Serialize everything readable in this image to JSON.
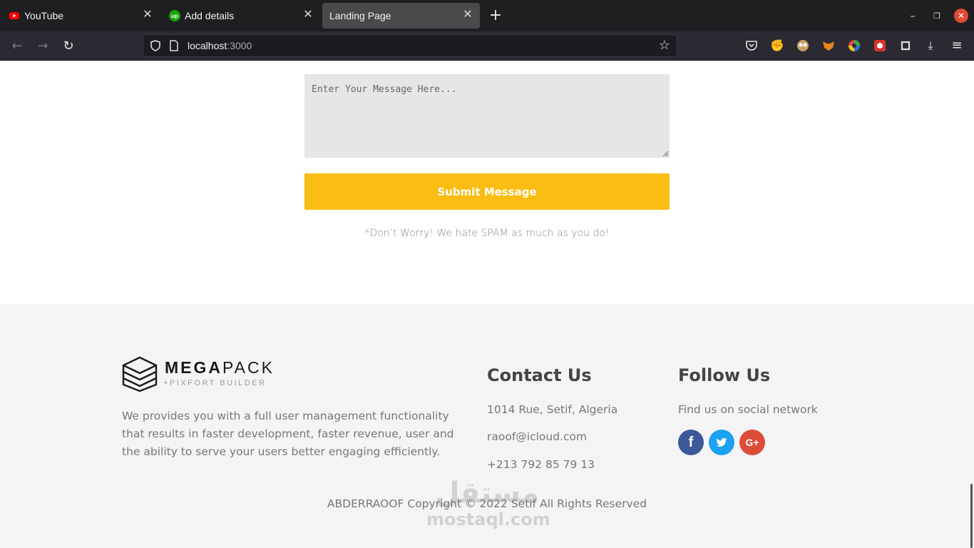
{
  "browser": {
    "tabs": [
      {
        "label": "YouTube",
        "icon": "youtube-icon",
        "active": false
      },
      {
        "label": "Add details",
        "icon": "upwork-icon",
        "active": false
      },
      {
        "label": "Landing Page",
        "icon": "",
        "active": true
      }
    ],
    "url_host": "localhost",
    "url_port": ":3000",
    "colors": {
      "tabbar": "#1f1f21",
      "toolbar": "#2b2a33",
      "active_tab": "#4a4a4d",
      "close_button": "#e14a35"
    }
  },
  "form": {
    "message_placeholder": "Enter Your Message Here...",
    "message_value": "",
    "submit_label": "Submit Message",
    "spam_note": "*Don’t Worry! We hate SPAM as much as you do!",
    "submit_color": "#fbbc13"
  },
  "footer": {
    "logo": {
      "mega": "MEGA",
      "pack": "PACK",
      "sub": "+PIXFORT BUILDER"
    },
    "about": "We provides you with a full user management functionality that results in faster development, faster revenue, user and the ability to serve your users better engaging efficiently.",
    "contact": {
      "title": "Contact Us",
      "address": "1014 Rue, Setif, Algeria",
      "email": "raoof@icloud.com",
      "phone": "+213 792 85 79 13"
    },
    "follow": {
      "title": "Follow Us",
      "text": "Find us on social network",
      "networks": [
        {
          "name": "facebook-icon",
          "glyph": "f",
          "color": "#3b5998"
        },
        {
          "name": "twitter-icon",
          "glyph": "t",
          "color": "#1da1f2"
        },
        {
          "name": "google-plus-icon",
          "glyph": "G+",
          "color": "#dd4b39"
        }
      ]
    },
    "copyright": "ABDERRAOOF Copyright © 2022 Setif All Rights Reserved",
    "background": "#f4f4f4"
  },
  "watermark": {
    "arabic": "مستقل",
    "latin": "mostaql.com"
  }
}
